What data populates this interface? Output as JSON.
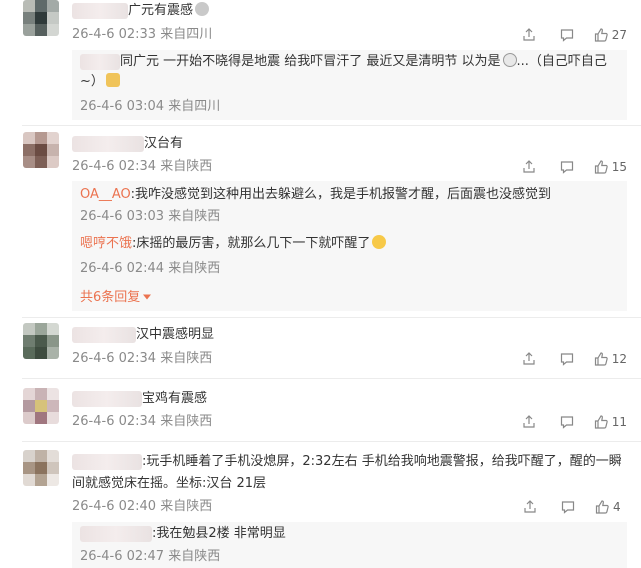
{
  "comments": [
    {
      "text": "广元有震感",
      "time": "26-4-6 02:33",
      "location": "来自四川",
      "likes": "27",
      "replies": [
        {
          "text": "同广元 一开始不晓得是地震 给我吓冒汗了 最近又是清明节 以为是",
          "text2": "...（自己吓自己",
          "text3": "~）",
          "time": "26-4-6 03:04",
          "location": "来自四川"
        }
      ]
    },
    {
      "text": "汉台有",
      "time": "26-4-6 02:34",
      "location": "来自陕西",
      "likes": "15",
      "replies": [
        {
          "user": "OA__AO",
          "text": ":我咋没感觉到这种用出去躲避么，我是手机报警才醒，后面震也没感觉到",
          "time": "26-4-6 03:03",
          "location": "来自陕西"
        },
        {
          "user": "嗯哼不饿",
          "text": ":床摇的最厉害，就那么几下一下就吓醒了",
          "time": "26-4-6 02:44",
          "location": "来自陕西"
        }
      ],
      "more_replies": "共6条回复"
    },
    {
      "text": "汉中震感明显",
      "time": "26-4-6 02:34",
      "location": "来自陕西",
      "likes": "12"
    },
    {
      "text": "宝鸡有震感",
      "time": "26-4-6 02:34",
      "location": "来自陕西",
      "likes": "11"
    },
    {
      "text": ":玩手机睡着了手机没熄屏，2:32左右 手机给我响地震警报，给我吓醒了，醒的一瞬",
      "text2": "间就感觉床在摇。坐标:汉台 21层",
      "time": "26-4-6 02:40",
      "location": "来自陕西",
      "likes": "4",
      "replies": [
        {
          "text": ":我在勉县2楼 非常明显",
          "time": "26-4-6 02:47",
          "location": "来自陕西"
        }
      ]
    }
  ],
  "icons": {
    "share": "share-icon",
    "comment": "comment-icon",
    "like": "thumbs-up-icon"
  },
  "colors": {
    "username": "#eb7350",
    "meta": "#8a8a8a",
    "reply_bg": "#f7f7f7"
  }
}
